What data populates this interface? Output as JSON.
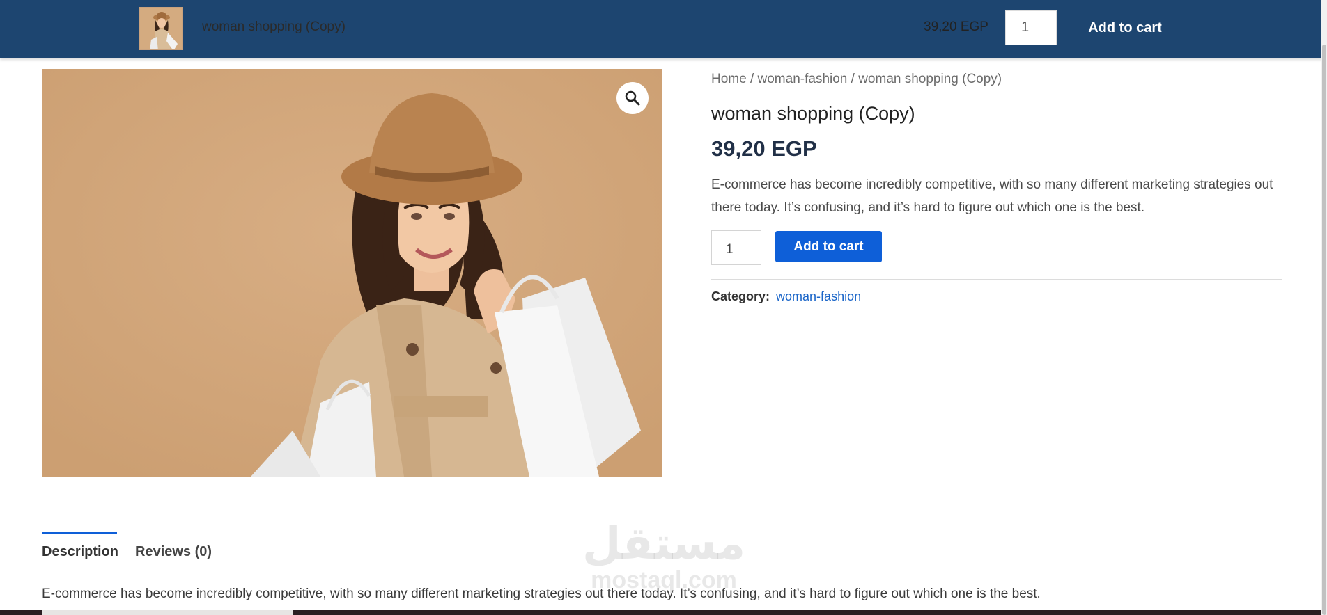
{
  "sticky_bar": {
    "product_title": "woman shopping (Copy)",
    "price": "39,20 EGP",
    "quantity": "1",
    "add_to_cart_label": "Add to cart"
  },
  "breadcrumb": "Home / woman-fashion / woman shopping (Copy)",
  "product": {
    "title": "woman shopping (Copy)",
    "price": "39,20 EGP",
    "short_description": "E-commerce has become incredibly competitive, with so many different marketing strategies out there today. It’s confusing, and it’s hard to figure out which one is the best.",
    "quantity": "1",
    "add_to_cart_label": "Add to cart",
    "category_label": "Category:",
    "category_value": "woman-fashion",
    "zoom_icon": "magnifier-icon"
  },
  "tabs": [
    {
      "label": "Description",
      "active": true
    },
    {
      "label": "Reviews (0)",
      "active": false
    }
  ],
  "description": "E-commerce has become incredibly competitive, with so many different marketing strategies out there today. It’s confusing, and it’s hard to figure out which one is the best.",
  "watermark": {
    "arabic": "مستقل",
    "latin": "mostaql.com"
  },
  "colors": {
    "header_bg": "#1d4570",
    "accent": "#0e5fd8",
    "price_text": "#213047",
    "image_bg": "#d2a67a"
  }
}
